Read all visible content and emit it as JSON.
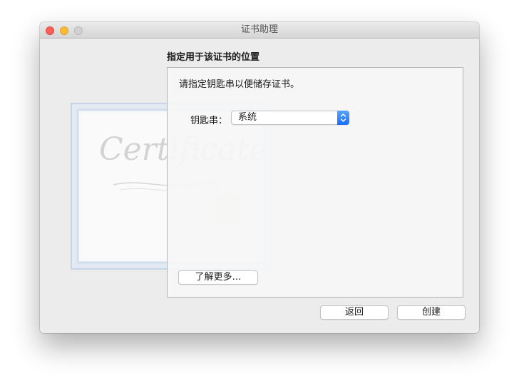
{
  "window": {
    "title": "证书助理",
    "traffic_lights": [
      "close",
      "minimize",
      "zoom"
    ]
  },
  "section": {
    "heading": "指定用于该证书的位置"
  },
  "panel": {
    "instruction": "请指定钥匙串以便储存证书。",
    "keychain_label": "钥匙串：",
    "keychain_value": "系统",
    "learn_more_label": "了解更多…"
  },
  "certificate_art": {
    "text": "Certificate"
  },
  "footer": {
    "back_label": "返回",
    "create_label": "创建"
  },
  "colors": {
    "close": "#fc5f57",
    "minimize": "#fdbc2e",
    "zoom": "#d1d1d1",
    "accent": "#1a6ff5"
  }
}
